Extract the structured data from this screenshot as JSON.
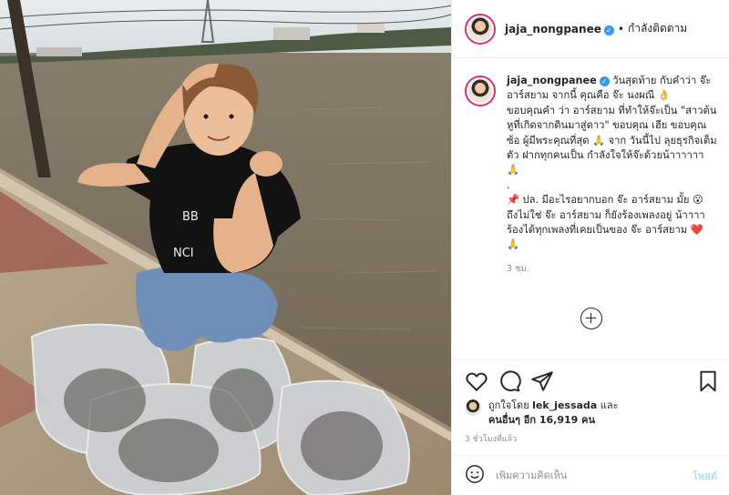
{
  "post": {
    "author": "jaja_nongpanee",
    "follow_dot": "•",
    "follow_label": "กำลังติดตาม",
    "caption": {
      "lines": [
        "วันสุดท้าย กับคำว่า จ๊ะ อาร์สยาม จากนี้ คุณคือ จ๊ะ นงผณี 👌",
        "ขอบคุณคำ ว่า อาร์สยาม ที่ทำให้จ๊ะเป็น \"สาวต้นหูที่เกิดจากดินมาสู่ดาว\" ขอบคุณ เฮีย ขอบคุณซ้อ ผู้มีพระคุณที่สุด 🙏 จาก วันนี้ไป ลุยธุรกิจเต็มตัว ฝากทุกคนเป็น กำลังใจให้จ๊ะด้วยน้าาาาาา 🙏",
        ".",
        "📌 ปล. มีอะไรอยากบอก จ๊ะ อาร์สยาม มั้ย 😮",
        "ถึงไม่ใช่ จ๊ะ อาร์สยาม ก็ยังร้องเพลงอยู่ น้าาาา ร้องได้ทุกเพลงที่เคยเป็นของ จ๊ะ อาร์สยาม ❤️ 🙏"
      ],
      "time": "3 ชม."
    },
    "likes": {
      "prefix": "ถูกใจโดย",
      "user": "lek_jessada",
      "and": "และ",
      "others": "คนอื่นๆ อีก 16,919 คน"
    },
    "timestamp": "3 ชั่วโมงที่แล้ว",
    "comment": {
      "placeholder": "เพิ่มความคิดเห็น",
      "post_label": "โพสต์"
    }
  },
  "icons": {
    "verified": "✓",
    "like": "heart-icon",
    "comment": "comment-icon",
    "share": "paper-plane-icon",
    "save": "bookmark-icon",
    "emoji": "smiley-icon",
    "more": "plus-circle-icon"
  },
  "colors": {
    "verified": "#3897f0",
    "story_ring": "#e1306c",
    "post_button": "#b2dffc",
    "muted": "#8e8e8e"
  }
}
